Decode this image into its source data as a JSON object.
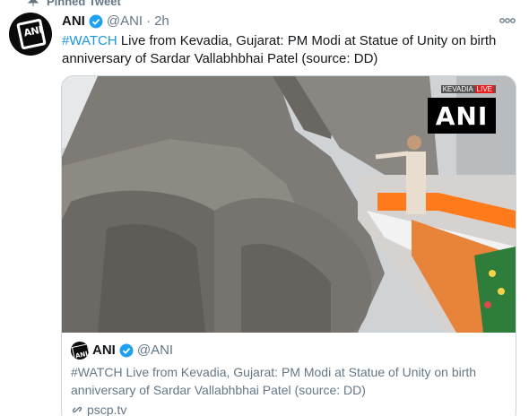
{
  "pinned": {
    "label": "Pinned Tweet"
  },
  "tweet": {
    "author_name": "ANI",
    "author_handle": "@ANI",
    "separator": "·",
    "time": "2h",
    "hashtag": "#WATCH",
    "text": " Live from Kevadia, Gujarat: PM Modi at Statue of Unity on birth anniversary of Sardar Vallabhbhai Patel  (source: DD)"
  },
  "media": {
    "overlay_location": "KEVADIA",
    "overlay_live": "LIVE",
    "overlay_logo": "ANI"
  },
  "quoted": {
    "author_name": "ANI",
    "author_handle": "@ANI",
    "text": "#WATCH Live from Kevadia, Gujarat: PM Modi at Statue of Unity on birth anniversary of Sardar Vallabhbhai Patel (source: DD)",
    "link": "pscp.tv"
  },
  "avatar_text": "ANI",
  "colors": {
    "accent": "#1b95e0",
    "secondary_text": "#657786",
    "verified": "#1da1f2"
  }
}
